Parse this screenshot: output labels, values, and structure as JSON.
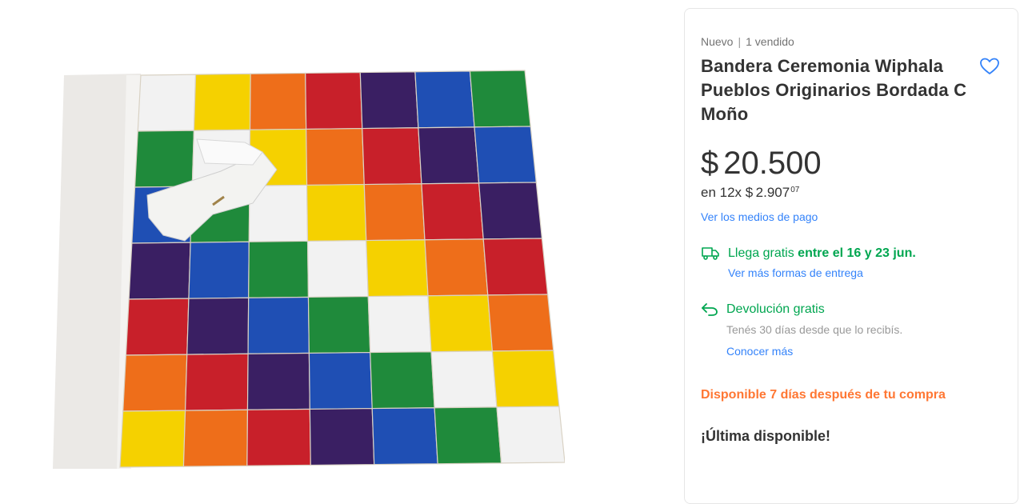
{
  "product": {
    "condition": "Nuevo",
    "sold_count": "1 vendido",
    "title": "Bandera Ceremonia Wiphala Pueblos Originarios Bordada C Moño",
    "favorite_icon": "heart-outline-icon"
  },
  "price": {
    "currency_symbol": "$",
    "amount": "20.500",
    "installments_prefix": "en 12x",
    "installment_currency": "$",
    "installment_amount": "2.907",
    "installment_cents": "07",
    "payment_link": "Ver los medios de pago"
  },
  "shipping": {
    "icon": "truck-icon",
    "text": "Llega gratis",
    "date_range": "entre el 16 y 23 jun.",
    "more_link": "Ver más formas de entrega"
  },
  "returns": {
    "icon": "return-arrow-icon",
    "text": "Devolución gratis",
    "detail": "Tenés 30 días desde que lo recibís.",
    "more_link": "Conocer más"
  },
  "availability": {
    "note": "Disponible 7 días después de tu compra",
    "stock": "¡Última disponible!"
  },
  "colors": {
    "accent_blue": "#3483fa",
    "green": "#00a650",
    "orange": "#ff7733"
  }
}
